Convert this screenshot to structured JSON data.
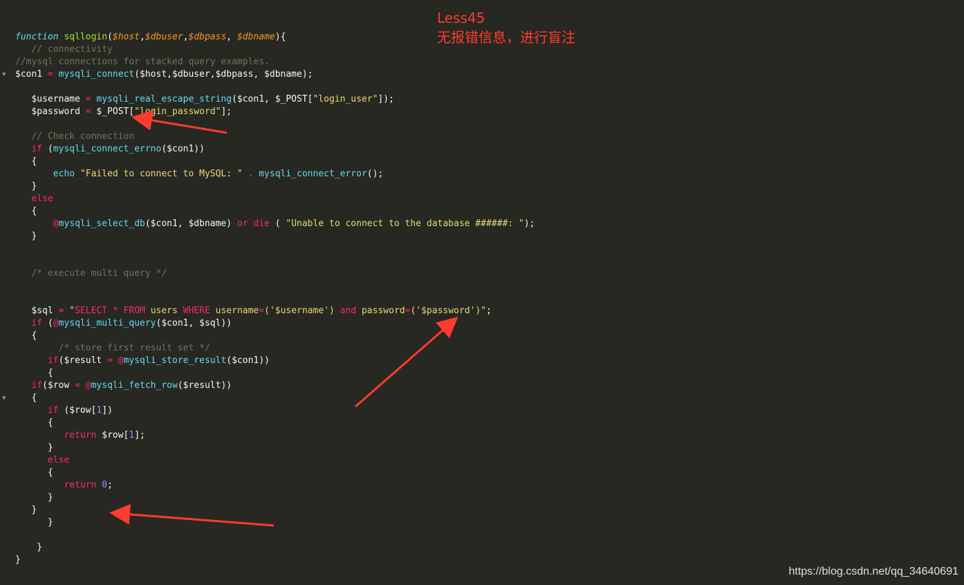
{
  "annotation": {
    "title": "Less45",
    "note": "无报错信息，进行盲注",
    "color": "#ff3b2f"
  },
  "watermark": "https://blog.csdn.net/qq_34640691",
  "theme": {
    "background": "#272822",
    "keyword": "#f92672",
    "function": "#66d9ef",
    "string": "#e6db74",
    "number": "#ae81ff",
    "comment": "#75715e",
    "parameter": "#fd971f",
    "name": "#a6e22e",
    "text": "#f8f8f2"
  },
  "code_lines": [
    [
      [
        "storage",
        "function"
      ],
      [
        "default",
        " "
      ],
      [
        "name",
        "sqllogin"
      ],
      [
        "default",
        "("
      ],
      [
        "param",
        "$host"
      ],
      [
        "default",
        ","
      ],
      [
        "param",
        "$dbuser"
      ],
      [
        "default",
        ","
      ],
      [
        "param",
        "$dbpass"
      ],
      [
        "default",
        ", "
      ],
      [
        "param",
        "$dbname"
      ],
      [
        "default",
        "){"
      ]
    ],
    [
      [
        "default",
        "   "
      ],
      [
        "cm",
        "// connectivity"
      ]
    ],
    [
      [
        "cm",
        "//mysql connections for stacked query examples."
      ]
    ],
    [
      [
        "default",
        "$con1 "
      ],
      [
        "kw",
        "="
      ],
      [
        "default",
        " "
      ],
      [
        "fn",
        "mysqli_connect"
      ],
      [
        "default",
        "($host,$dbuser,$dbpass, $dbname);"
      ]
    ],
    [],
    [
      [
        "default",
        "   $username "
      ],
      [
        "kw",
        "="
      ],
      [
        "default",
        " "
      ],
      [
        "fn",
        "mysqli_real_escape_string"
      ],
      [
        "default",
        "($con1, $_POST["
      ],
      [
        "str",
        "\"login_user\""
      ],
      [
        "default",
        "]);"
      ]
    ],
    [
      [
        "default",
        "   $password "
      ],
      [
        "kw",
        "="
      ],
      [
        "default",
        " $_POST["
      ],
      [
        "str",
        "\"login_password\""
      ],
      [
        "default",
        "];"
      ]
    ],
    [],
    [
      [
        "default",
        "   "
      ],
      [
        "cm",
        "// Check connection"
      ]
    ],
    [
      [
        "default",
        "   "
      ],
      [
        "kw",
        "if"
      ],
      [
        "default",
        " ("
      ],
      [
        "fn",
        "mysqli_connect_errno"
      ],
      [
        "default",
        "($con1))"
      ]
    ],
    [
      [
        "default",
        "   {"
      ]
    ],
    [
      [
        "default",
        "       "
      ],
      [
        "fn",
        "echo"
      ],
      [
        "default",
        " "
      ],
      [
        "str",
        "\"Failed to connect to MySQL: \""
      ],
      [
        "default",
        " "
      ],
      [
        "kw",
        "."
      ],
      [
        "default",
        " "
      ],
      [
        "fn",
        "mysqli_connect_error"
      ],
      [
        "default",
        "();"
      ]
    ],
    [
      [
        "default",
        "   }"
      ]
    ],
    [
      [
        "default",
        "   "
      ],
      [
        "kw",
        "else"
      ]
    ],
    [
      [
        "default",
        "   {"
      ]
    ],
    [
      [
        "default",
        "       "
      ],
      [
        "kw",
        "@"
      ],
      [
        "fn",
        "mysqli_select_db"
      ],
      [
        "default",
        "($con1, $dbname) "
      ],
      [
        "kw",
        "or"
      ],
      [
        "default",
        " "
      ],
      [
        "kw",
        "die"
      ],
      [
        "default",
        " ( "
      ],
      [
        "str",
        "\"Unable to connect to the database ######: \""
      ],
      [
        "default",
        ");"
      ]
    ],
    [
      [
        "default",
        "   }"
      ]
    ],
    [],
    [],
    [
      [
        "default",
        "   "
      ],
      [
        "cm",
        "/* execute multi query */"
      ]
    ],
    [],
    [],
    [
      [
        "default",
        "   $sql "
      ],
      [
        "kw",
        "="
      ],
      [
        "default",
        " "
      ],
      [
        "str",
        "\""
      ],
      [
        "kw",
        "SELECT"
      ],
      [
        "str",
        " "
      ],
      [
        "kw",
        "*"
      ],
      [
        "str",
        " "
      ],
      [
        "kw",
        "FROM"
      ],
      [
        "str",
        " users "
      ],
      [
        "kw",
        "WHERE"
      ],
      [
        "str",
        " username"
      ],
      [
        "kw",
        "="
      ],
      [
        "str",
        "('$username') "
      ],
      [
        "kw",
        "and"
      ],
      [
        "str",
        " password"
      ],
      [
        "kw",
        "="
      ],
      [
        "str",
        "('$password')\""
      ],
      [
        "default",
        ";"
      ]
    ],
    [
      [
        "default",
        "   "
      ],
      [
        "kw",
        "if"
      ],
      [
        "default",
        " ("
      ],
      [
        "kw",
        "@"
      ],
      [
        "fn",
        "mysqli_multi_query"
      ],
      [
        "default",
        "($con1, $sql))"
      ]
    ],
    [
      [
        "default",
        "   {"
      ]
    ],
    [
      [
        "default",
        "        "
      ],
      [
        "cm",
        "/* store first result set */"
      ]
    ],
    [
      [
        "default",
        "      "
      ],
      [
        "kw",
        "if"
      ],
      [
        "default",
        "($result "
      ],
      [
        "kw",
        "="
      ],
      [
        "default",
        " "
      ],
      [
        "kw",
        "@"
      ],
      [
        "fn",
        "mysqli_store_result"
      ],
      [
        "default",
        "($con1))"
      ]
    ],
    [
      [
        "default",
        "      {"
      ]
    ],
    [
      [
        "default",
        "   "
      ],
      [
        "kw",
        "if"
      ],
      [
        "default",
        "($row "
      ],
      [
        "kw",
        "="
      ],
      [
        "default",
        " "
      ],
      [
        "kw",
        "@"
      ],
      [
        "fn",
        "mysqli_fetch_row"
      ],
      [
        "default",
        "($result))"
      ]
    ],
    [
      [
        "default",
        "   {"
      ]
    ],
    [
      [
        "default",
        "      "
      ],
      [
        "kw",
        "if"
      ],
      [
        "default",
        " ($row["
      ],
      [
        "num",
        "1"
      ],
      [
        "default",
        "])"
      ]
    ],
    [
      [
        "default",
        "      {"
      ]
    ],
    [
      [
        "default",
        "         "
      ],
      [
        "kw",
        "return"
      ],
      [
        "default",
        " $row["
      ],
      [
        "num",
        "1"
      ],
      [
        "default",
        "];"
      ]
    ],
    [
      [
        "default",
        "      }"
      ]
    ],
    [
      [
        "default",
        "      "
      ],
      [
        "kw",
        "else"
      ]
    ],
    [
      [
        "default",
        "      {"
      ]
    ],
    [
      [
        "default",
        "         "
      ],
      [
        "kw",
        "return"
      ],
      [
        "default",
        " "
      ],
      [
        "num",
        "0"
      ],
      [
        "default",
        ";"
      ]
    ],
    [
      [
        "default",
        "      }"
      ]
    ],
    [
      [
        "default",
        "   }"
      ]
    ],
    [
      [
        "default",
        "      }"
      ]
    ],
    [],
    [
      [
        "default",
        "    }"
      ]
    ],
    [
      [
        "default",
        "}"
      ]
    ]
  ],
  "fold_markers": [
    3,
    29
  ],
  "fold_icon": "triangle-down-icon"
}
